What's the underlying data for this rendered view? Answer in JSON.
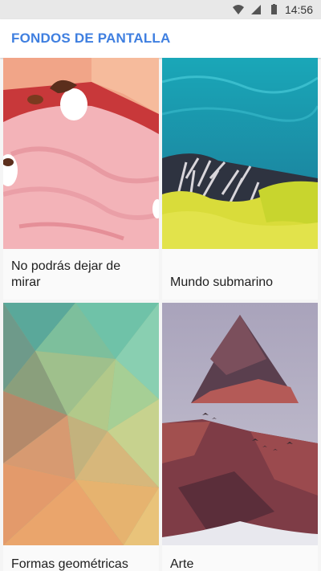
{
  "status_bar": {
    "time": "14:56",
    "icons": [
      "wifi-icon",
      "signal-icon",
      "battery-icon"
    ]
  },
  "app_bar": {
    "title": "FONDOS DE PANTALLA",
    "accent_color": "#3f7fe0"
  },
  "categories": [
    {
      "label": "No podrás dejar de mirar"
    },
    {
      "label": "Mundo submarino"
    },
    {
      "label": "Formas geométricas"
    },
    {
      "label": "Arte"
    }
  ]
}
